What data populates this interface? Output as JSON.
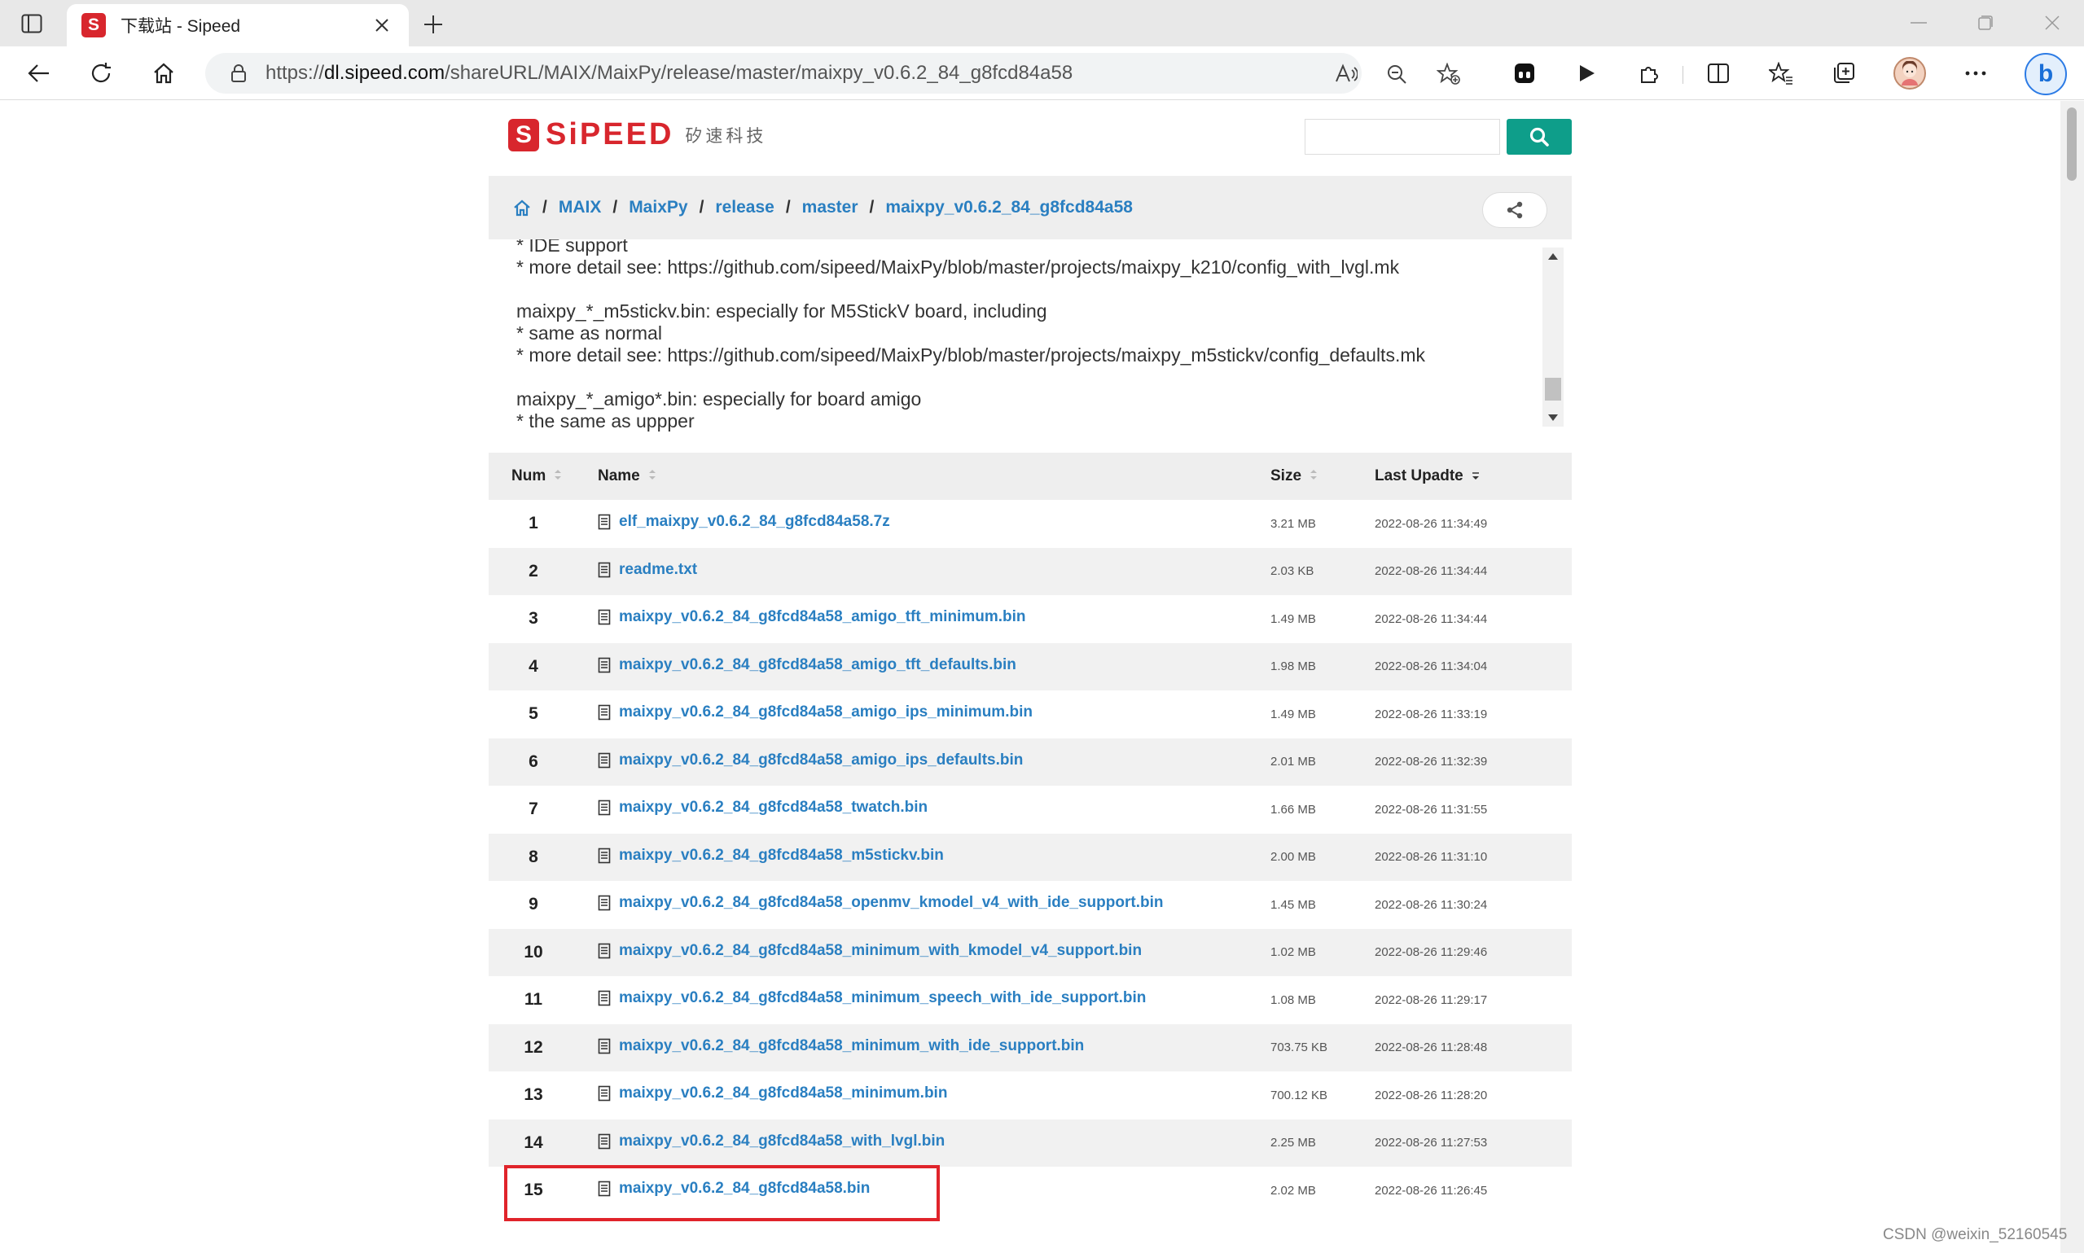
{
  "browser": {
    "tab_title": "下载站 - Sipeed",
    "favicon_letter": "S",
    "url_scheme": "https://",
    "url_host": "dl.sipeed.com",
    "url_path": "/shareURL/MAIX/MaixPy/release/master/maixpy_v0.6.2_84_g8fcd84a58",
    "accent_color": "#2c7be5"
  },
  "site": {
    "logo_letter": "S",
    "logo_text": "SiPEED",
    "logo_subtitle": "矽速科技",
    "brand_color": "#d8262d",
    "search_button_color": "#0e9e8a",
    "search_placeholder": ""
  },
  "breadcrumb": [
    "MAIX",
    "MaixPy",
    "release",
    "master",
    "maixpy_v0.6.2_84_g8fcd84a58"
  ],
  "readme": {
    "text": "* IDE support\n* more detail see: https://github.com/sipeed/MaixPy/blob/master/projects/maixpy_k210/config_with_lvgl.mk\n\nmaixpy_*_m5stickv.bin: especially for M5StickV board, including\n* same as normal\n* more detail see: https://github.com/sipeed/MaixPy/blob/master/projects/maixpy_m5stickv/config_defaults.mk\n\nmaixpy_*_amigo*.bin: especially for board amigo\n* the same as uppper"
  },
  "table": {
    "headers": {
      "num": "Num",
      "name": "Name",
      "size": "Size",
      "date": "Last Upadte"
    },
    "rows": [
      {
        "num": "1",
        "name": "elf_maixpy_v0.6.2_84_g8fcd84a58.7z",
        "size": "3.21 MB",
        "date": "2022-08-26 11:34:49"
      },
      {
        "num": "2",
        "name": "readme.txt",
        "size": "2.03 KB",
        "date": "2022-08-26 11:34:44"
      },
      {
        "num": "3",
        "name": "maixpy_v0.6.2_84_g8fcd84a58_amigo_tft_minimum.bin",
        "size": "1.49 MB",
        "date": "2022-08-26 11:34:44"
      },
      {
        "num": "4",
        "name": "maixpy_v0.6.2_84_g8fcd84a58_amigo_tft_defaults.bin",
        "size": "1.98 MB",
        "date": "2022-08-26 11:34:04"
      },
      {
        "num": "5",
        "name": "maixpy_v0.6.2_84_g8fcd84a58_amigo_ips_minimum.bin",
        "size": "1.49 MB",
        "date": "2022-08-26 11:33:19"
      },
      {
        "num": "6",
        "name": "maixpy_v0.6.2_84_g8fcd84a58_amigo_ips_defaults.bin",
        "size": "2.01 MB",
        "date": "2022-08-26 11:32:39"
      },
      {
        "num": "7",
        "name": "maixpy_v0.6.2_84_g8fcd84a58_twatch.bin",
        "size": "1.66 MB",
        "date": "2022-08-26 11:31:55"
      },
      {
        "num": "8",
        "name": "maixpy_v0.6.2_84_g8fcd84a58_m5stickv.bin",
        "size": "2.00 MB",
        "date": "2022-08-26 11:31:10"
      },
      {
        "num": "9",
        "name": "maixpy_v0.6.2_84_g8fcd84a58_openmv_kmodel_v4_with_ide_support.bin",
        "size": "1.45 MB",
        "date": "2022-08-26 11:30:24"
      },
      {
        "num": "10",
        "name": "maixpy_v0.6.2_84_g8fcd84a58_minimum_with_kmodel_v4_support.bin",
        "size": "1.02 MB",
        "date": "2022-08-26 11:29:46"
      },
      {
        "num": "11",
        "name": "maixpy_v0.6.2_84_g8fcd84a58_minimum_speech_with_ide_support.bin",
        "size": "1.08 MB",
        "date": "2022-08-26 11:29:17"
      },
      {
        "num": "12",
        "name": "maixpy_v0.6.2_84_g8fcd84a58_minimum_with_ide_support.bin",
        "size": "703.75 KB",
        "date": "2022-08-26 11:28:48"
      },
      {
        "num": "13",
        "name": "maixpy_v0.6.2_84_g8fcd84a58_minimum.bin",
        "size": "700.12 KB",
        "date": "2022-08-26 11:28:20"
      },
      {
        "num": "14",
        "name": "maixpy_v0.6.2_84_g8fcd84a58_with_lvgl.bin",
        "size": "2.25 MB",
        "date": "2022-08-26 11:27:53"
      },
      {
        "num": "15",
        "name": "maixpy_v0.6.2_84_g8fcd84a58.bin",
        "size": "2.02 MB",
        "date": "2022-08-26 11:26:45"
      }
    ],
    "highlighted_row": "15",
    "highlight_color": "#e0242b"
  },
  "watermark": "CSDN @weixin_52160545"
}
